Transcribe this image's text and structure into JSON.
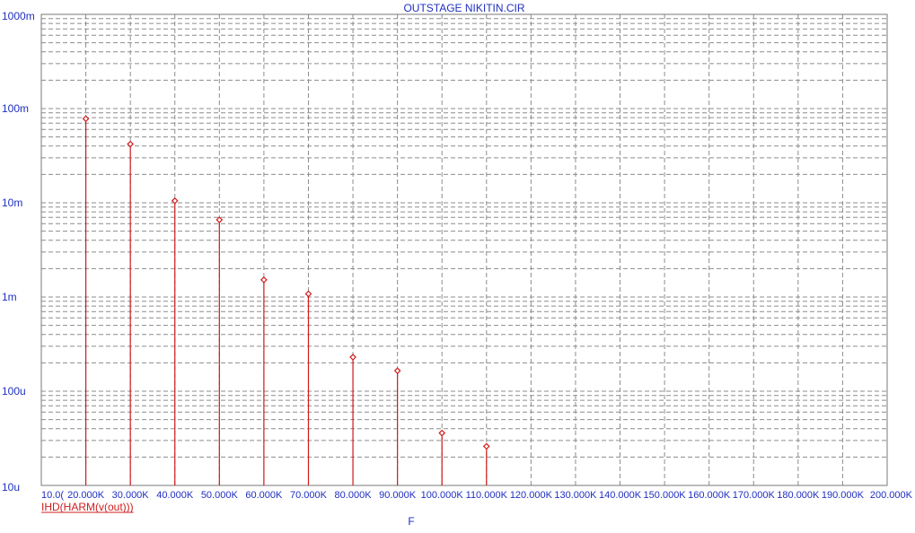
{
  "chart_data": {
    "type": "stem",
    "title": "OUTSTAGE NIKITIN.CIR",
    "xlabel": "F",
    "yscale": "log",
    "xlim": [
      10000,
      200000
    ],
    "ylim": [
      1e-05,
      1
    ],
    "x_ticks": [
      {
        "value": 10000,
        "label": "10.0("
      },
      {
        "value": 20000,
        "label": "20.000K"
      },
      {
        "value": 30000,
        "label": "30.000K"
      },
      {
        "value": 40000,
        "label": "40.000K"
      },
      {
        "value": 50000,
        "label": "50.000K"
      },
      {
        "value": 60000,
        "label": "60.000K"
      },
      {
        "value": 70000,
        "label": "70.000K"
      },
      {
        "value": 80000,
        "label": "80.000K"
      },
      {
        "value": 90000,
        "label": "90.000K"
      },
      {
        "value": 100000,
        "label": "100.000K"
      },
      {
        "value": 110000,
        "label": "110.000K"
      },
      {
        "value": 120000,
        "label": "120.000K"
      },
      {
        "value": 130000,
        "label": "130.000K"
      },
      {
        "value": 140000,
        "label": "140.000K"
      },
      {
        "value": 150000,
        "label": "150.000K"
      },
      {
        "value": 160000,
        "label": "160.000K"
      },
      {
        "value": 170000,
        "label": "170.000K"
      },
      {
        "value": 180000,
        "label": "180.000K"
      },
      {
        "value": 190000,
        "label": "190.000K"
      },
      {
        "value": 200000,
        "label": "200.000K"
      }
    ],
    "y_ticks": [
      {
        "value": 1,
        "label": "1000m"
      },
      {
        "value": 0.1,
        "label": "100m"
      },
      {
        "value": 0.01,
        "label": "10m"
      },
      {
        "value": 0.001,
        "label": "1m"
      },
      {
        "value": 0.0001,
        "label": "100u"
      },
      {
        "value": 1e-05,
        "label": "10u"
      }
    ],
    "grid": true,
    "series": [
      {
        "name": "IHD(HARM(v(out)))",
        "color": "#d01c1c",
        "x": [
          20000,
          30000,
          40000,
          50000,
          60000,
          70000,
          80000,
          90000,
          100000,
          110000
        ],
        "values": [
          0.078,
          0.042,
          0.0105,
          0.0066,
          0.00152,
          0.00108,
          0.00023,
          0.000165,
          3.6e-05,
          2.6e-05
        ]
      }
    ]
  }
}
